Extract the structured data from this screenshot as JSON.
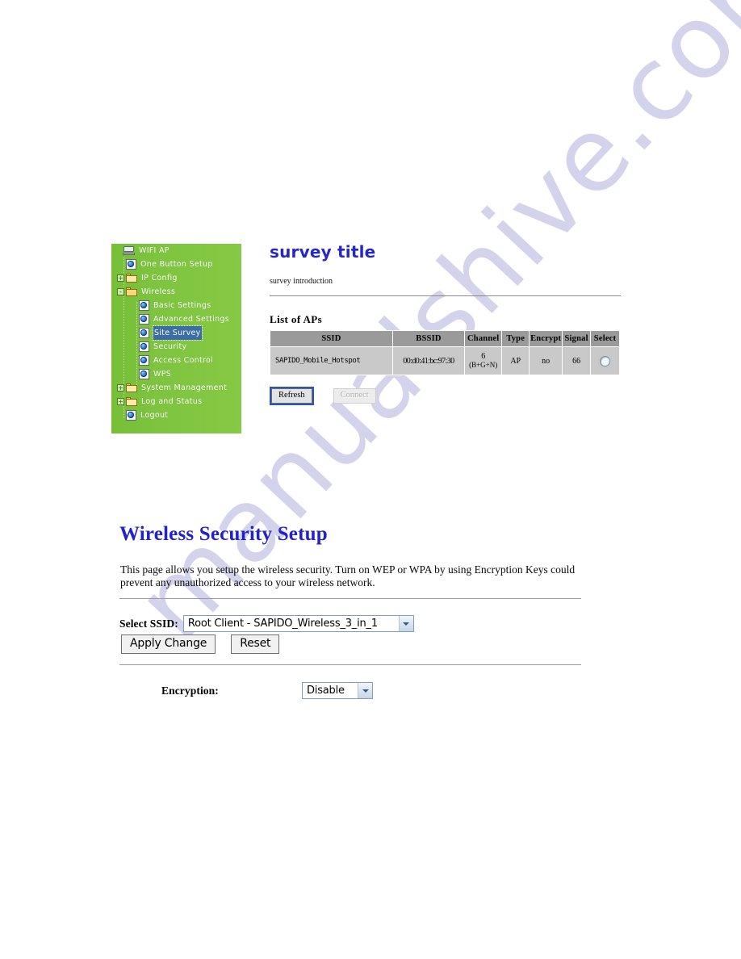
{
  "watermark": {
    "text": "manualshive.com"
  },
  "sidebar": {
    "root": {
      "label": "WIFI AP",
      "icon": "monitor-icon"
    },
    "items": [
      {
        "label": "One Button Setup",
        "icon": "globe-doc-icon",
        "level": 1,
        "toggle": "none",
        "selected": false
      },
      {
        "label": "IP Config",
        "icon": "folder-icon",
        "level": 1,
        "toggle": "+",
        "selected": false
      },
      {
        "label": "Wireless",
        "icon": "folder-open-icon",
        "level": 1,
        "toggle": "-",
        "selected": false
      },
      {
        "label": "Basic Settings",
        "icon": "globe-doc-icon",
        "level": 2,
        "toggle": "none",
        "selected": false
      },
      {
        "label": "Advanced Settings",
        "icon": "globe-doc-icon",
        "level": 2,
        "toggle": "none",
        "selected": false
      },
      {
        "label": "Site Survey",
        "icon": "globe-doc-icon",
        "level": 2,
        "toggle": "none",
        "selected": true
      },
      {
        "label": "Security",
        "icon": "globe-doc-icon",
        "level": 2,
        "toggle": "none",
        "selected": false
      },
      {
        "label": "Access Control",
        "icon": "globe-doc-icon",
        "level": 2,
        "toggle": "none",
        "selected": false
      },
      {
        "label": "WPS",
        "icon": "globe-doc-icon",
        "level": 2,
        "toggle": "none",
        "selected": false
      },
      {
        "label": "System Management",
        "icon": "folder-icon",
        "level": 1,
        "toggle": "+",
        "selected": false
      },
      {
        "label": "Log and Status",
        "icon": "folder-icon",
        "level": 1,
        "toggle": "+",
        "selected": false
      },
      {
        "label": "Logout",
        "icon": "globe-doc-icon",
        "level": 1,
        "toggle": "none",
        "selected": false
      }
    ],
    "background_color": "#7ac13c",
    "selected_color": "#3b6ea5"
  },
  "survey": {
    "title": "survey title",
    "intro": "survey introduction",
    "list_heading": "List of APs",
    "table": {
      "headers": [
        "SSID",
        "BSSID",
        "Channel",
        "Type",
        "Encrypt",
        "Signal",
        "Select"
      ],
      "rows": [
        {
          "ssid": "SAPIDO_Mobile_Hotspot",
          "bssid": "00:d0:41:bc:97:30",
          "channel_number": "6",
          "channel_mode": "(B+G+N)",
          "type": "AP",
          "encrypt": "no",
          "signal": "66",
          "select": "radio-unselected"
        }
      ]
    },
    "buttons": {
      "refresh": "Refresh",
      "connect": "Connect",
      "connect_disabled": true,
      "refresh_focused": true
    }
  },
  "security": {
    "title": "Wireless Security Setup",
    "description": "This page allows you setup the wireless security. Turn on WEP or WPA by using Encryption Keys could prevent any unauthorized access to your wireless network.",
    "select_ssid": {
      "label": "Select SSID:",
      "value": "Root Client - SAPIDO_Wireless_3_in_1"
    },
    "buttons": {
      "apply": "Apply Change",
      "reset": "Reset"
    },
    "encryption": {
      "label": "Encryption:",
      "value": "Disable"
    }
  },
  "colors": {
    "title_blue": "#2222cc",
    "survey_title_blue": "#2727c8",
    "nav_green": "#7ac13c",
    "table_header_grey": "#9a9a9a",
    "table_cell_grey": "#c9c9c9",
    "watermark_purple": "#b9bbe2"
  }
}
